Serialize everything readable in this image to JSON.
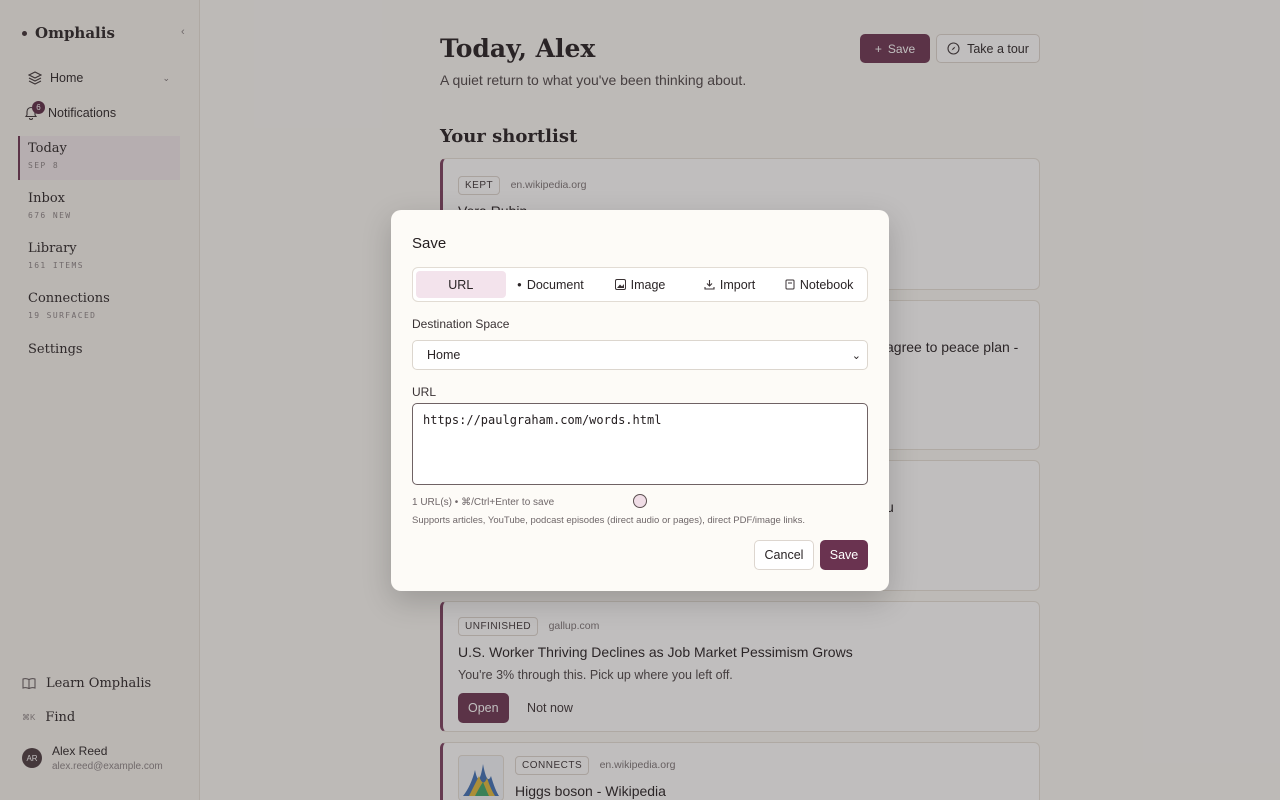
{
  "app": {
    "name": "Omphalis",
    "collapse_icon": "‹"
  },
  "sidebar": {
    "home_label": "Home",
    "notifications_label": "Notifications",
    "notifications_count": "6",
    "items": [
      {
        "label": "Today",
        "sub": "SEP 8"
      },
      {
        "label": "Inbox",
        "sub": "676 NEW"
      },
      {
        "label": "Library",
        "sub": "161 ITEMS"
      },
      {
        "label": "Connections",
        "sub": "19 SURFACED"
      },
      {
        "label": "Settings",
        "sub": ""
      }
    ],
    "learn_label": "Learn Omphalis",
    "find_shortcut": "⌘K",
    "find_label": "Find",
    "user": {
      "initials": "AR",
      "name": "Alex Reed",
      "email": "alex.reed@example.com"
    }
  },
  "header": {
    "title": "Today, Alex",
    "subtitle": "A quiet return to what you've been thinking about.",
    "save_label": "Save",
    "tour_label": "Take a tour"
  },
  "shortlist": {
    "title": "Your shortlist",
    "cards": [
      {
        "tag": "KEPT",
        "domain": "en.wikipedia.org",
        "title": "Vera Rubin"
      },
      {
        "title_fragment": "agree to peace plan -"
      },
      {
        "title_fragment": "u"
      },
      {
        "tag": "UNFINISHED",
        "domain": "gallup.com",
        "title": "U.S. Worker Thriving Declines as Job Market Pessimism Grows",
        "text": "You're 3% through this. Pick up where you left off.",
        "open_label": "Open",
        "notnow_label": "Not now"
      },
      {
        "tag": "CONNECTS",
        "domain": "en.wikipedia.org",
        "title": "Higgs boson - Wikipedia"
      }
    ]
  },
  "modal": {
    "title": "Save",
    "tabs": [
      "URL",
      "Document",
      "Image",
      "Import",
      "Notebook"
    ],
    "active_tab": "URL",
    "destination_label": "Destination Space",
    "destination_value": "Home",
    "url_label": "URL",
    "url_value": "https://paulgraham.com/words.html",
    "hint_count": "1 URL(s) • ⌘/Ctrl+Enter to save",
    "hint_supports": "Supports articles, YouTube, podcast episodes (direct audio or pages), direct PDF/image links.",
    "cancel_label": "Cancel",
    "save_label": "Save"
  },
  "colors": {
    "accent": "#6a3350",
    "accent_soft": "#f3e3ec",
    "background": "#fbf9f5"
  }
}
